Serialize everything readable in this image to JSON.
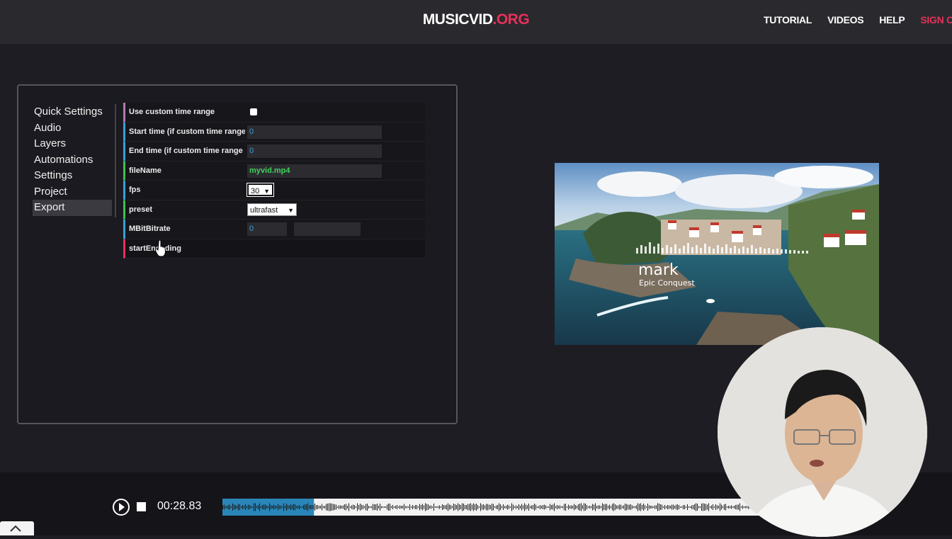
{
  "header": {
    "logo_main": "MUSICVID",
    "logo_accent": ".ORG",
    "nav": [
      {
        "label": "TUTORIAL"
      },
      {
        "label": "VIDEOS"
      },
      {
        "label": "HELP"
      },
      {
        "label": "SIGN OUT"
      }
    ]
  },
  "sidebar": {
    "items": [
      {
        "label": "Quick Settings"
      },
      {
        "label": "Audio"
      },
      {
        "label": "Layers"
      },
      {
        "label": "Automations"
      },
      {
        "label": "Settings"
      },
      {
        "label": "Project"
      },
      {
        "label": "Export",
        "active": true
      }
    ]
  },
  "export": {
    "rows": [
      {
        "label": "Use custom time range",
        "type": "checkbox",
        "checked": false,
        "accent": "#b07ab0"
      },
      {
        "label": "Start time (if custom time range is",
        "type": "text",
        "value": "0",
        "accent": "#3aa0d8"
      },
      {
        "label": "End time (if custom time range is",
        "type": "text",
        "value": "0",
        "accent": "#3aa0d8"
      },
      {
        "label": "fileName",
        "type": "text",
        "value": "myvid.mp4",
        "accent": "#40c050"
      },
      {
        "label": "fps",
        "type": "select",
        "value": "30",
        "accent": "#3aa0d8"
      },
      {
        "label": "preset",
        "type": "select",
        "value": "ultrafast",
        "accent": "#40c050"
      },
      {
        "label": "MBitBitrate",
        "type": "number",
        "value": "0",
        "accent": "#3aa0d8"
      },
      {
        "label": "startEncoding",
        "type": "button",
        "accent": "#e8305a"
      }
    ]
  },
  "preview": {
    "title": "mark",
    "subtitle": "Epic Conquest"
  },
  "player": {
    "time": "00:28.83",
    "progress": 0.17
  },
  "colors": {
    "accent": "#e8305a",
    "background": "#1e1d24",
    "playhead_fill": "#2a86b8"
  }
}
